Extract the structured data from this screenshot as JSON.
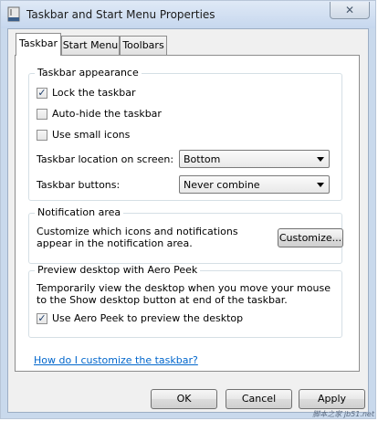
{
  "window": {
    "title": "Taskbar and Start Menu Properties",
    "close_symbol": "✕"
  },
  "tabs": [
    {
      "label": "Taskbar",
      "active": true
    },
    {
      "label": "Start Menu",
      "active": false
    },
    {
      "label": "Toolbars",
      "active": false
    }
  ],
  "appearance": {
    "group_title": "Taskbar appearance",
    "lock": {
      "label": "Lock the taskbar",
      "checked": true
    },
    "autohide": {
      "label": "Auto-hide the taskbar",
      "checked": false
    },
    "small_icons": {
      "label": "Use small icons",
      "checked": false
    },
    "location_label": "Taskbar location on screen:",
    "location_value": "Bottom",
    "buttons_label": "Taskbar buttons:",
    "buttons_value": "Never combine"
  },
  "notification": {
    "group_title": "Notification area",
    "description": "Customize which icons and notifications appear in the notification area.",
    "customize_button": "Customize..."
  },
  "aero_peek": {
    "group_title": "Preview desktop with Aero Peek",
    "description": "Temporarily view the desktop when you move your mouse to the Show desktop button at end of the taskbar.",
    "use_peek": {
      "label": "Use Aero Peek to preview the desktop",
      "checked": true
    }
  },
  "help_link": "How do I customize the taskbar?",
  "footer": {
    "ok": "OK",
    "cancel": "Cancel",
    "apply": "Apply"
  },
  "watermark": "脚本之家 jb51.net",
  "colors": {
    "link": "#0066cc",
    "check": "#1d3d6b"
  }
}
